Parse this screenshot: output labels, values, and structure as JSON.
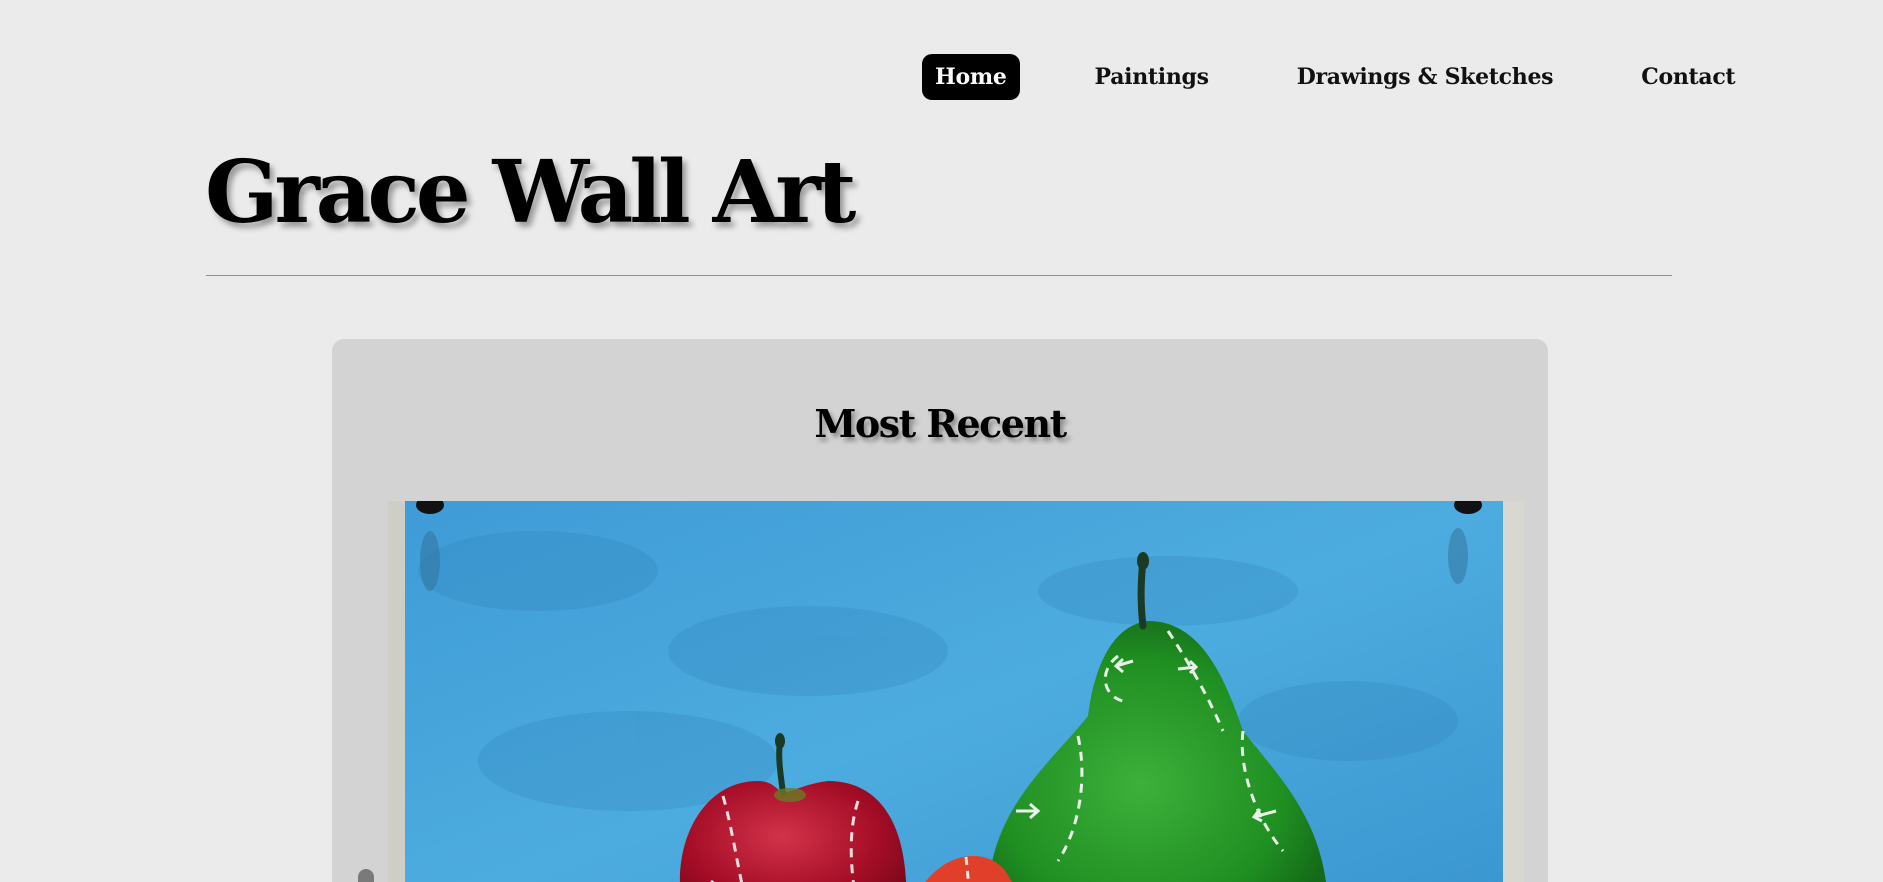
{
  "nav": {
    "items": [
      {
        "label": "Home",
        "active": true
      },
      {
        "label": "Paintings",
        "active": false
      },
      {
        "label": "Drawings & Sketches",
        "active": false
      },
      {
        "label": "Contact",
        "active": false
      }
    ]
  },
  "header": {
    "title": "Grace Wall Art"
  },
  "featured": {
    "heading": "Most Recent"
  },
  "colors": {
    "background": "#ebebeb",
    "card": "#d3d3d3",
    "active_nav": "#000000",
    "painting_sky": "#4aa6dc",
    "pear": "#2a9a2a",
    "apple": "#a8102a"
  }
}
